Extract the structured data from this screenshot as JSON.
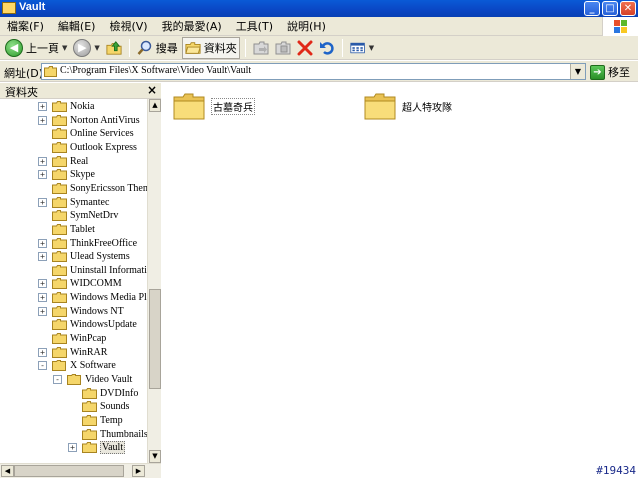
{
  "window": {
    "title": "Vault"
  },
  "menu": {
    "items": [
      "檔案(F)",
      "編輯(E)",
      "檢視(V)",
      "我的最愛(A)",
      "工具(T)",
      "說明(H)"
    ]
  },
  "toolbar": {
    "back_label": "上一頁",
    "search_label": "搜尋",
    "folders_label": "資料夾"
  },
  "address": {
    "label": "網址(D)",
    "value": "C:\\Program Files\\X Software\\Video Vault\\Vault",
    "go_label": "移至"
  },
  "left_pane": {
    "title": "資料夾",
    "tree": [
      {
        "label": "Nokia",
        "expander": "+"
      },
      {
        "label": "Norton AntiVirus",
        "expander": "+"
      },
      {
        "label": "Online Services",
        "expander": ""
      },
      {
        "label": "Outlook Express",
        "expander": ""
      },
      {
        "label": "Real",
        "expander": "+"
      },
      {
        "label": "Skype",
        "expander": "+"
      },
      {
        "label": "SonyEricsson Themes",
        "expander": ""
      },
      {
        "label": "Symantec",
        "expander": "+"
      },
      {
        "label": "SymNetDrv",
        "expander": ""
      },
      {
        "label": "Tablet",
        "expander": ""
      },
      {
        "label": "ThinkFreeOffice",
        "expander": "+"
      },
      {
        "label": "Ulead Systems",
        "expander": "+"
      },
      {
        "label": "Uninstall Information",
        "expander": ""
      },
      {
        "label": "WIDCOMM",
        "expander": "+"
      },
      {
        "label": "Windows Media Player",
        "expander": "+"
      },
      {
        "label": "Windows NT",
        "expander": "+"
      },
      {
        "label": "WindowsUpdate",
        "expander": ""
      },
      {
        "label": "WinPcap",
        "expander": ""
      },
      {
        "label": "WinRAR",
        "expander": "+"
      },
      {
        "label": "X Software",
        "expander": "-"
      },
      {
        "label": "Video Vault",
        "expander": "-"
      },
      {
        "label": "DVDInfo",
        "expander": ""
      },
      {
        "label": "Sounds",
        "expander": ""
      },
      {
        "label": "Temp",
        "expander": ""
      },
      {
        "label": "Thumbnails",
        "expander": ""
      },
      {
        "label": "Vault",
        "expander": "+"
      }
    ]
  },
  "content": {
    "folders": [
      {
        "label": "古墓奇兵"
      },
      {
        "label": "超人特攻隊"
      }
    ]
  },
  "overlay": {
    "image_number": "#19434"
  },
  "colors": {
    "titlebar": "#0a46c4",
    "chrome": "#ece9d8",
    "folder": "#f5d66a"
  }
}
